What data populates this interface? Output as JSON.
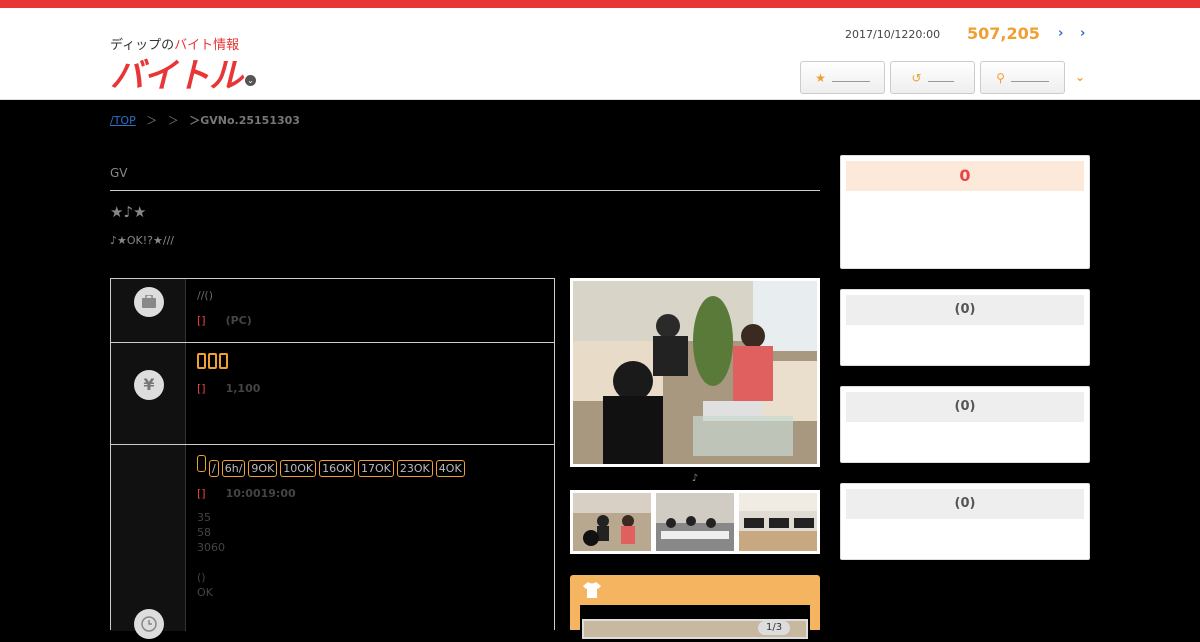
{
  "header": {
    "logo_sub_prefix": "ディップの",
    "logo_sub_red": "バイト情報",
    "logo_main": "バイトル",
    "logo_chevron": "⌄",
    "date": "2017/10/1220:00",
    "count": "507,205",
    "arrow1": "›",
    "arrow2": "›",
    "buttons": [
      {
        "icon": "★",
        "label": ""
      },
      {
        "icon": "↺",
        "label": ""
      },
      {
        "icon": "⚲",
        "label": ""
      }
    ],
    "menu_chevron": "⌄"
  },
  "breadcrumb": {
    "top": "/TOP",
    "sep1": "＞",
    "sep2": "＞",
    "last": "＞GVNo.25151303"
  },
  "job": {
    "company": "GV",
    "catch": "★♪★",
    "subcatch": "♪★OK!?★///"
  },
  "rows": {
    "job_type": {
      "icon": "briefcase-icon",
      "line1": "//()",
      "tag": "[]",
      "detail": "(PC)"
    },
    "pay": {
      "icon": "yen-icon",
      "symbol": "¥",
      "tag": "[]",
      "detail": "1,100"
    },
    "time": {
      "icon": "clock-icon",
      "tags": [
        "/",
        "6h/",
        "9OK",
        "10OK",
        "16OK",
        "17OK",
        "23OK",
        "4OK"
      ],
      "tag": "[]",
      "detail": "10:0019:00",
      "lines": [
        "35",
        "58",
        "3060",
        "",
        "()",
        "OK"
      ]
    }
  },
  "photo": {
    "caption": "♪"
  },
  "panel": {
    "icon": "shirt-icon",
    "pager": "1/3"
  },
  "sidebar": [
    {
      "head": "0"
    },
    {
      "head": "(0)"
    },
    {
      "head": "(0)"
    },
    {
      "head": "(0)"
    }
  ]
}
